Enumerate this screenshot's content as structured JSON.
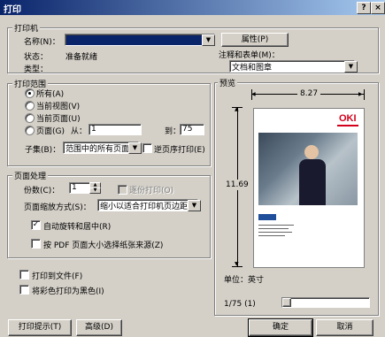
{
  "window": {
    "title": "打印",
    "help_button": "?",
    "close_button": "×"
  },
  "printer": {
    "group_label": "打印机",
    "name_label": "名称(N)：",
    "name_value": "",
    "properties_button": "属性(P)",
    "status_label": "状态：",
    "status_value": "准备就绪",
    "type_label": "类型：",
    "type_value": "",
    "comments_label": "注释和表单(M)：",
    "comments_value": "文档和图章"
  },
  "range": {
    "group_label": "打印范围",
    "options": [
      "所有(A)",
      "当前视图(V)",
      "当前页面(U)",
      "页面(G)"
    ],
    "selected_index": 0,
    "from_label": "从：",
    "from_value": "1",
    "to_label": "到：",
    "to_value": "75",
    "subset_label": "子集(B)：",
    "subset_value": "范围中的所有页面",
    "reverse_label": "逆页序打印(E)"
  },
  "handling": {
    "group_label": "页面处理",
    "copies_label": "份数(C)：",
    "copies_value": "1",
    "collate_label": "逐份打印(O)",
    "scaling_label": "页面缩放方式(S)：",
    "scaling_value": "缩小以适合打印机页边距",
    "autorotate_label": "自动旋转和居中(R)",
    "autorotate_checked": true,
    "paper_by_pdf_label": "按 PDF 页面大小选择纸张来源(Z)"
  },
  "options": {
    "print_to_file_label": "打印到文件(F)",
    "print_color_black_label": "将彩色打印为黑色(I)"
  },
  "preview": {
    "group_label": "预览",
    "width_label": "8.27",
    "height_label": "11.69",
    "unit_label": "单位：英寸",
    "page_counter": "1/75 (1)",
    "brand_logo": "OKI"
  },
  "buttons": {
    "tips": "打印提示(T)",
    "advanced": "高级(D)",
    "ok": "确定",
    "cancel": "取消"
  },
  "icons": {
    "dropdown": "chevron-down-icon",
    "spin_up": "spin-up-icon",
    "spin_down": "spin-down-icon"
  },
  "colors": {
    "title_bar_start": "#0a246a",
    "title_bar_end": "#a6caf0",
    "dialog_bg": "#d4d0c8",
    "brand_red": "#d3001c"
  }
}
